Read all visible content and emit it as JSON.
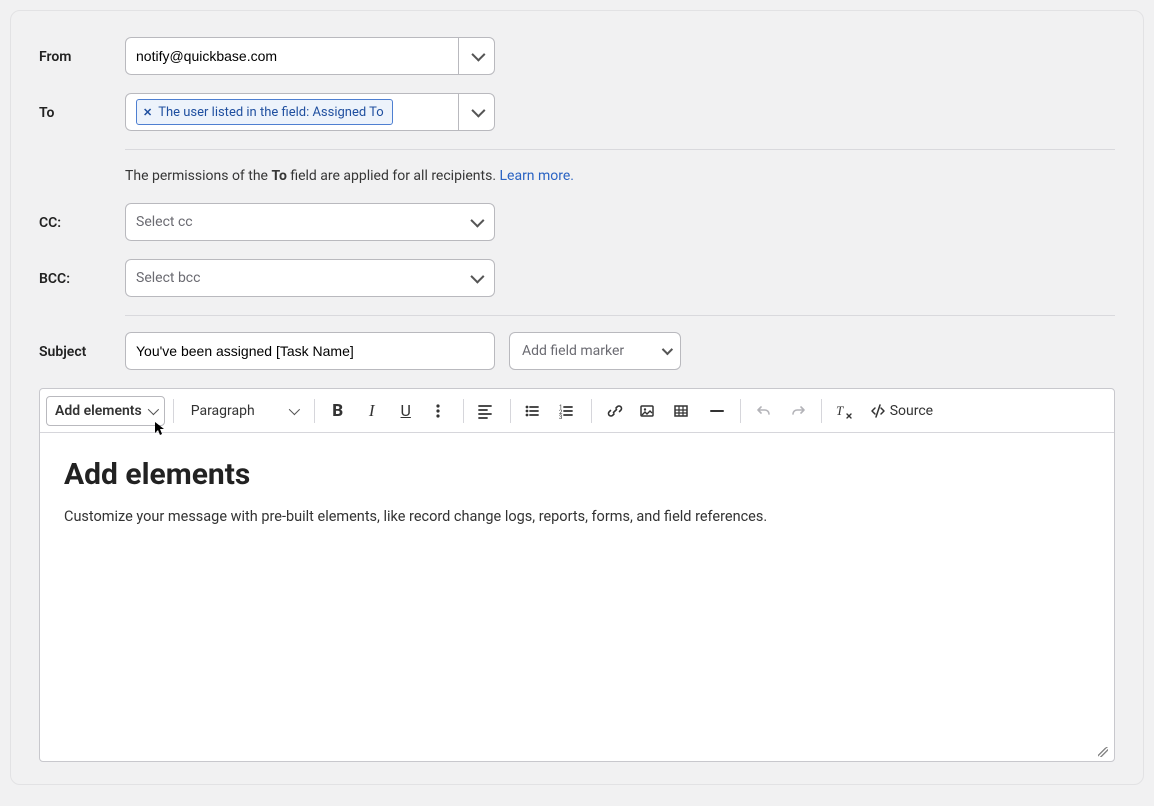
{
  "labels": {
    "from": "From",
    "to": "To",
    "cc": "CC:",
    "bcc": "BCC:",
    "subject": "Subject"
  },
  "from": {
    "value": "notify@quickbase.com"
  },
  "to": {
    "tag": "The user listed in the field: Assigned To"
  },
  "cc": {
    "placeholder": "Select cc"
  },
  "bcc": {
    "placeholder": "Select bcc"
  },
  "note": {
    "prefix": "The permissions of the ",
    "bold": "To",
    "suffix": " field are applied for all recipients. ",
    "link": "Learn more."
  },
  "subject": {
    "value": "You've been assigned [Task Name]"
  },
  "marker": {
    "placeholder": "Add field marker"
  },
  "toolbar": {
    "addElements": "Add elements",
    "paragraph": "Paragraph",
    "source": "Source"
  },
  "body": {
    "heading": "Add elements",
    "para": "Customize your message with pre-built elements, like record change logs, reports, forms, and field references."
  }
}
